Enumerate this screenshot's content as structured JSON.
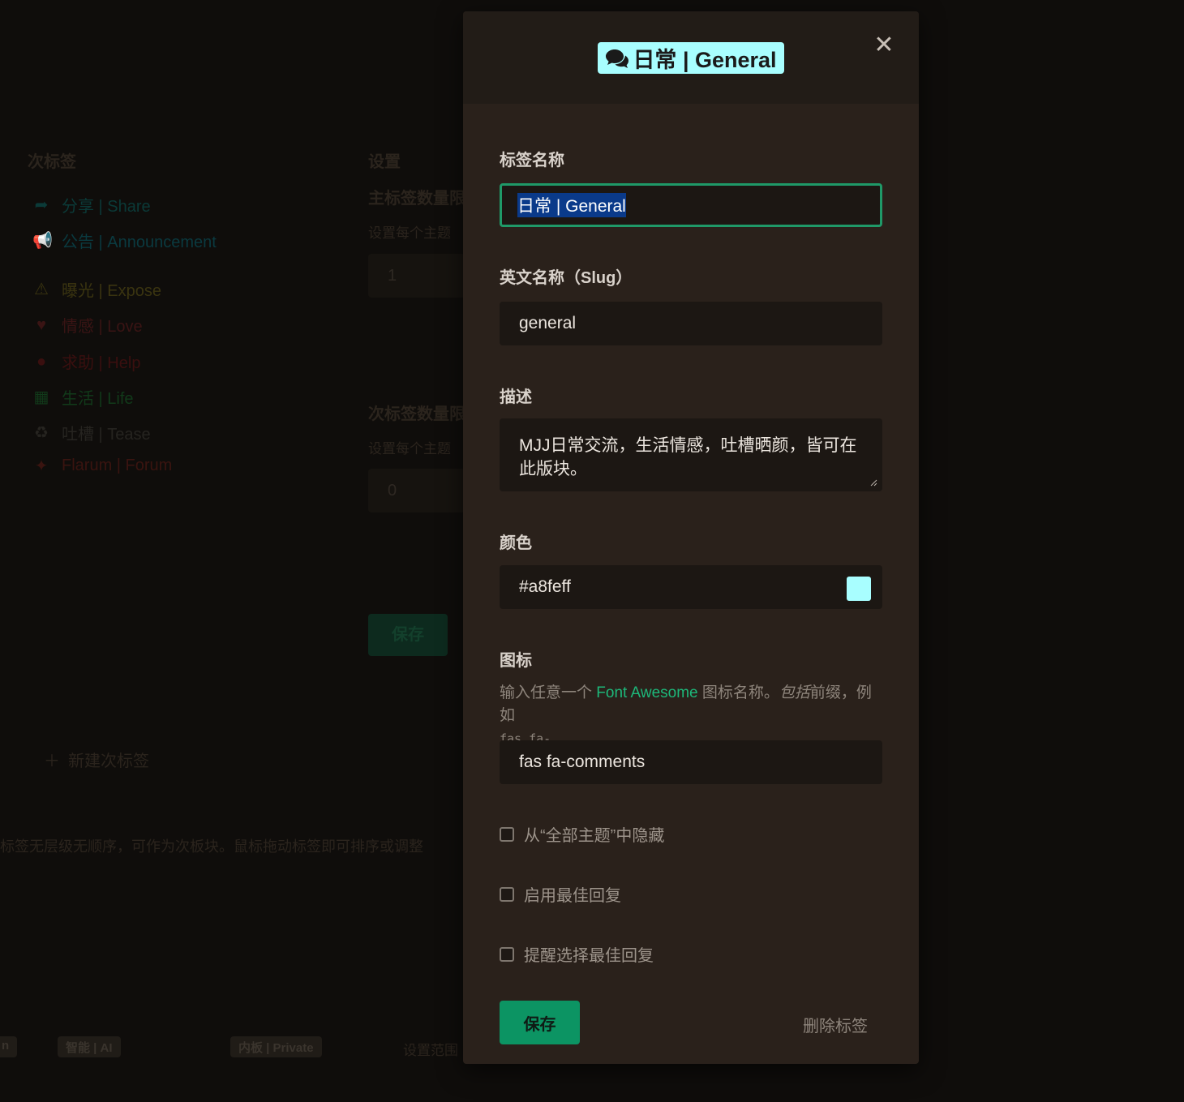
{
  "background": {
    "secondary_tags_heading": "次标签",
    "settings_heading": "设置",
    "primary_limit_heading": "主标签数量限",
    "primary_limit_help": "设置每个主题",
    "primary_limit_value": "1",
    "secondary_limit_heading": "次标签数量限",
    "secondary_limit_help": "设置每个主题",
    "secondary_limit_value": "0",
    "save_label": "保存",
    "new_secondary_tag": "新建次标签",
    "footer_note": "标签无层级无顺序，可作为次板块。鼠标拖动标签即可排序或调整",
    "tags": [
      {
        "label": "分享 | Share",
        "color": "#0b3a38",
        "icon": "share-icon"
      },
      {
        "label": "公告 | Announcement",
        "color": "#0a3a40",
        "icon": "bullhorn-icon"
      },
      {
        "label": "曝光 | Expose",
        "color": "#3a3410",
        "icon": "warning-icon"
      },
      {
        "label": "情感 | Love",
        "color": "#3a1414",
        "icon": "heart-icon"
      },
      {
        "label": "求助 | Help",
        "color": "#3a0f0f",
        "icon": "question-icon"
      },
      {
        "label": "生活 | Life",
        "color": "#113a1a",
        "icon": "grid-icon"
      },
      {
        "label": "吐槽 | Tease",
        "color": "#262420",
        "icon": "recycle-icon"
      },
      {
        "label": "Flarum | Forum",
        "color": "#3a1410",
        "icon": "flarum-icon"
      }
    ],
    "bottom_chips": [
      {
        "label": "n"
      },
      {
        "label": "智能 | AI"
      },
      {
        "label": "内板 | Private"
      },
      {
        "label": "设置范围"
      }
    ]
  },
  "modal": {
    "badge": {
      "icon": "comments-icon",
      "label": "日常 | General",
      "color": "#a8feff"
    },
    "close_icon": "close-icon",
    "name_label": "标签名称",
    "name_value": "日常 | General",
    "slug_label": "英文名称（Slug）",
    "slug_value": "general",
    "description_label": "描述",
    "description_value": "MJJ日常交流，生活情感，吐槽晒颜，皆可在此版块。",
    "color_label": "颜色",
    "color_value": "#a8feff",
    "icon_label": "图标",
    "icon_help_prefix": "输入任意一个 ",
    "icon_help_link": "Font Awesome",
    "icon_help_middle": " 图标名称。",
    "icon_help_em": "包括",
    "icon_help_suffix": "前缀，例如",
    "icon_help_code": "fas fa-",
    "icon_value": "fas fa-comments",
    "checkbox_hide": "从“全部主题”中隐藏",
    "checkbox_best_answer": "启用最佳回复",
    "checkbox_remind": "提醒选择最佳回复",
    "save_label": "保存",
    "delete_label": "删除标签",
    "accent_color": "#0c9463"
  }
}
